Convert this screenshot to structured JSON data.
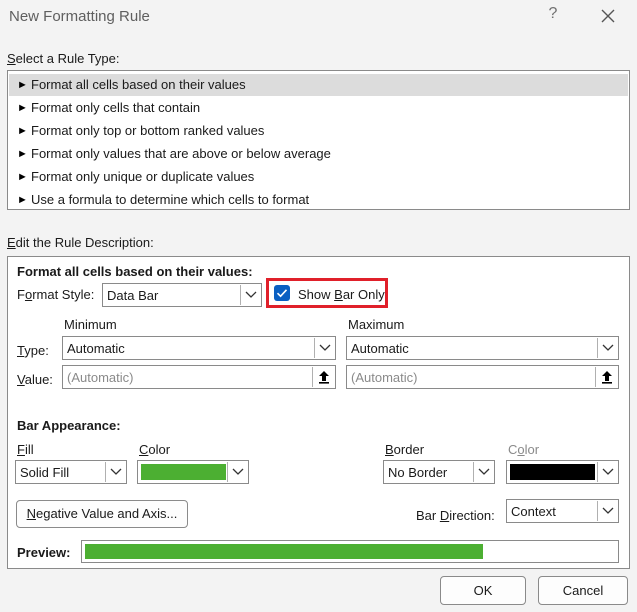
{
  "window": {
    "title": "New Formatting Rule",
    "help_glyph": "?"
  },
  "rule_type": {
    "label": "Select a Rule Type:",
    "items": [
      "Format all cells based on their values",
      "Format only cells that contain",
      "Format only top or bottom ranked values",
      "Format only values that are above or below average",
      "Format only unique or duplicate values",
      "Use a formula to determine which cells to format"
    ],
    "selected_index": 0
  },
  "description": {
    "label": "Edit the Rule Description:",
    "heading": "Format all cells based on their values:",
    "format_style_label": "Format Style:",
    "format_style_value": "Data Bar",
    "show_bar_only_label": "Show Bar Only",
    "show_bar_only_checked": true,
    "highlight_color": "#e0202a",
    "minimum": {
      "heading": "Minimum",
      "type": "Automatic",
      "value_placeholder": "(Automatic)"
    },
    "maximum": {
      "heading": "Maximum",
      "type": "Automatic",
      "value_placeholder": "(Automatic)"
    },
    "type_label": "Type:",
    "value_label": "Value:",
    "bar_appearance": {
      "heading": "Bar Appearance:",
      "fill_label": "Fill",
      "fill_value": "Solid Fill",
      "color_label": "Color",
      "fill_color": "#4caf32",
      "border_label": "Border",
      "border_value": "No Border",
      "border_color_label": "Color",
      "border_color": "#000000",
      "negative_button": "Negative Value and Axis...",
      "bar_direction_label": "Bar Direction:",
      "bar_direction_value": "Context"
    },
    "preview_label": "Preview:",
    "preview_fill_fraction": 0.75,
    "preview_color": "#4caf32"
  },
  "buttons": {
    "ok": "OK",
    "cancel": "Cancel"
  }
}
